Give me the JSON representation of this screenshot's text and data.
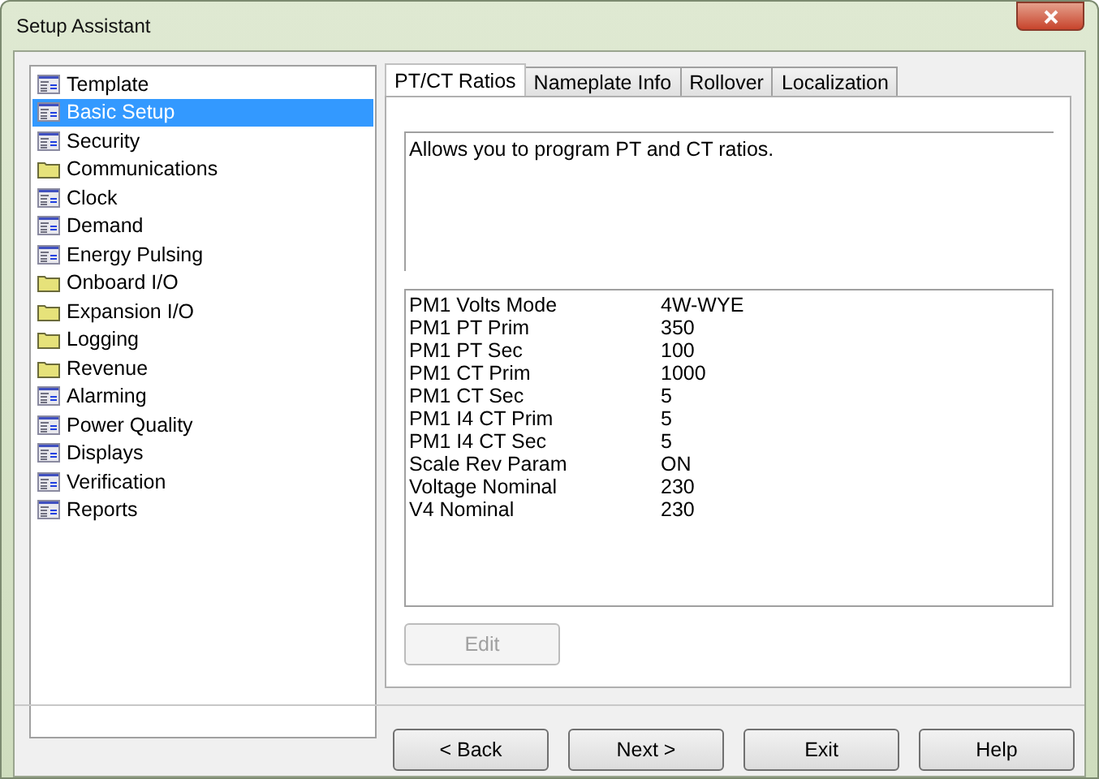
{
  "window": {
    "title": "Setup Assistant"
  },
  "sidebar": {
    "items": [
      {
        "label": "Template",
        "kind": "page",
        "selected": false
      },
      {
        "label": "Basic Setup",
        "kind": "page",
        "selected": true
      },
      {
        "label": "Security",
        "kind": "page",
        "selected": false
      },
      {
        "label": "Communications",
        "kind": "folder",
        "selected": false
      },
      {
        "label": "Clock",
        "kind": "page",
        "selected": false
      },
      {
        "label": "Demand",
        "kind": "page",
        "selected": false
      },
      {
        "label": "Energy Pulsing",
        "kind": "page",
        "selected": false
      },
      {
        "label": "Onboard I/O",
        "kind": "folder",
        "selected": false
      },
      {
        "label": "Expansion I/O",
        "kind": "folder",
        "selected": false
      },
      {
        "label": "Logging",
        "kind": "folder",
        "selected": false
      },
      {
        "label": "Revenue",
        "kind": "folder",
        "selected": false
      },
      {
        "label": "Alarming",
        "kind": "page",
        "selected": false
      },
      {
        "label": "Power Quality",
        "kind": "page",
        "selected": false
      },
      {
        "label": "Displays",
        "kind": "page",
        "selected": false
      },
      {
        "label": "Verification",
        "kind": "page",
        "selected": false
      },
      {
        "label": "Reports",
        "kind": "page",
        "selected": false
      }
    ]
  },
  "tabs": [
    {
      "label": "PT/CT Ratios",
      "selected": true
    },
    {
      "label": "Nameplate Info",
      "selected": false
    },
    {
      "label": "Rollover",
      "selected": false
    },
    {
      "label": "Localization",
      "selected": false
    }
  ],
  "description": "Allows you to program PT and CT ratios.",
  "parameters": [
    {
      "name": "PM1 Volts Mode",
      "value": "4W-WYE"
    },
    {
      "name": "PM1 PT Prim",
      "value": "350"
    },
    {
      "name": "PM1 PT Sec",
      "value": "100"
    },
    {
      "name": "PM1 CT Prim",
      "value": "1000"
    },
    {
      "name": "PM1 CT Sec",
      "value": "5"
    },
    {
      "name": "PM1 I4 CT Prim",
      "value": "5"
    },
    {
      "name": "PM1 I4 CT Sec",
      "value": "5"
    },
    {
      "name": "Scale Rev Param",
      "value": "ON"
    },
    {
      "name": "Voltage Nominal",
      "value": "230"
    },
    {
      "name": "V4 Nominal",
      "value": "230"
    }
  ],
  "edit_button": {
    "label": "Edit",
    "disabled": true
  },
  "buttons": [
    {
      "label": "< Back"
    },
    {
      "label": "Next >"
    },
    {
      "label": "Exit"
    },
    {
      "label": "Help"
    }
  ]
}
